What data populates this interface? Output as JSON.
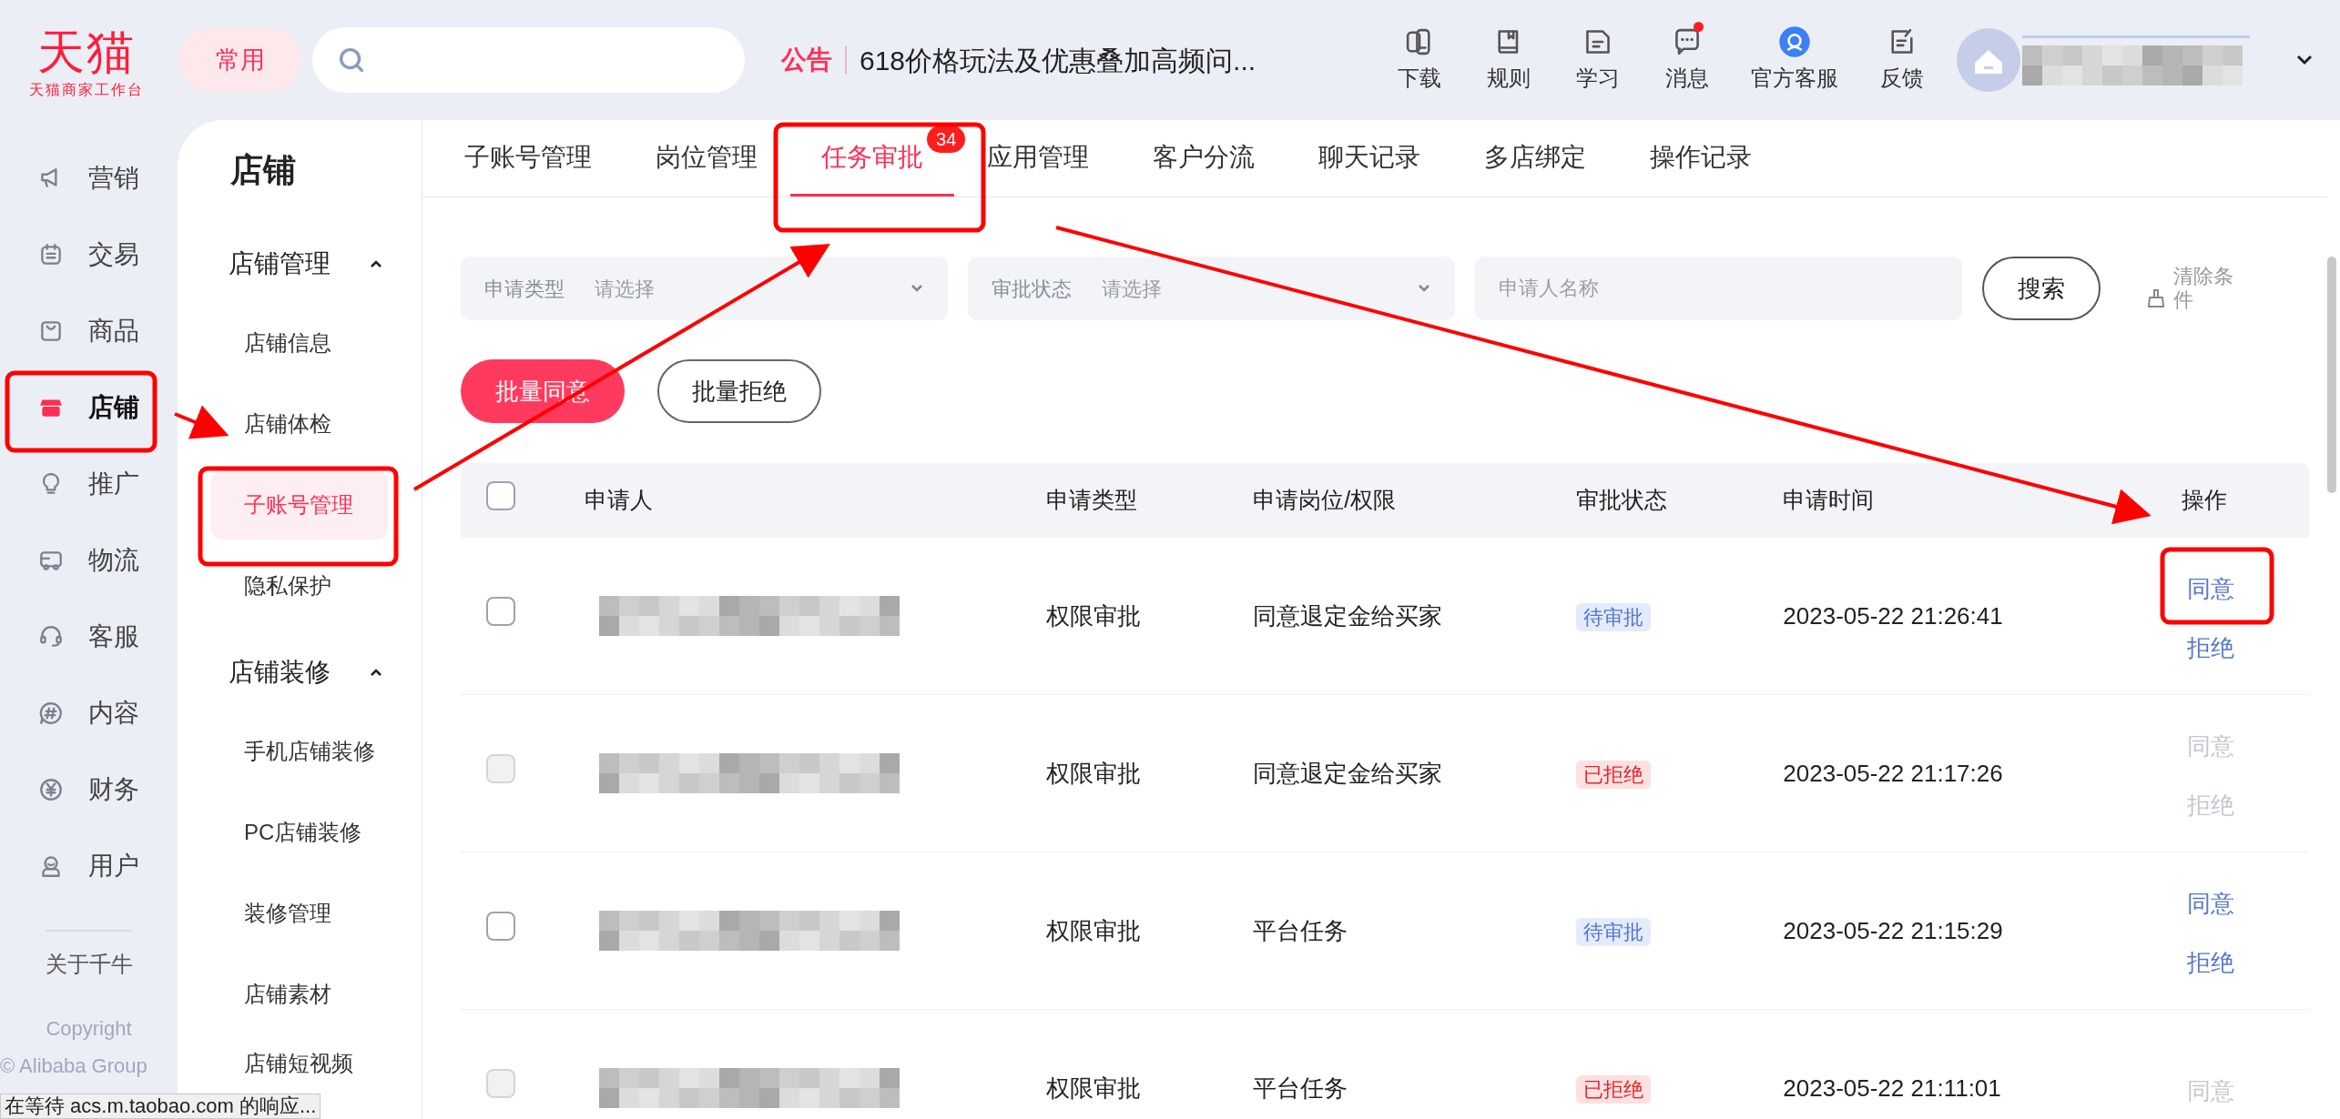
{
  "logo": {
    "name": "天猫",
    "subtitle": "天猫商家工作台"
  },
  "header": {
    "common_button": "常用",
    "notice_label": "公告",
    "notice_text": "618价格玩法及优惠叠加高频问...",
    "tools": [
      {
        "label": "下载",
        "kind": "download",
        "badge": false
      },
      {
        "label": "规则",
        "kind": "book",
        "badge": false
      },
      {
        "label": "学习",
        "kind": "doc",
        "badge": false
      },
      {
        "label": "消息",
        "kind": "chat",
        "badge": true
      },
      {
        "label": "官方客服",
        "kind": "service",
        "badge": false
      },
      {
        "label": "反馈",
        "kind": "feedback",
        "badge": false
      }
    ]
  },
  "nav": {
    "items": [
      {
        "label": "营销",
        "kind": "megaphone",
        "selected": false
      },
      {
        "label": "交易",
        "kind": "calendar",
        "selected": false
      },
      {
        "label": "商品",
        "kind": "bag",
        "selected": false
      },
      {
        "label": "店铺",
        "kind": "store",
        "selected": true
      },
      {
        "label": "推广",
        "kind": "bulb",
        "selected": false
      },
      {
        "label": "物流",
        "kind": "truck",
        "selected": false
      },
      {
        "label": "客服",
        "kind": "headset",
        "selected": false
      },
      {
        "label": "内容",
        "kind": "hash",
        "selected": false
      },
      {
        "label": "财务",
        "kind": "yen",
        "selected": false
      },
      {
        "label": "用户",
        "kind": "user",
        "selected": false
      }
    ],
    "about": "关于千牛",
    "copyright": "Copyright",
    "company": "© Alibaba Group"
  },
  "sidebar": {
    "title": "店铺",
    "groups": [
      {
        "label": "店铺管理",
        "expanded": true,
        "items": [
          {
            "label": "店铺信息",
            "selected": false
          },
          {
            "label": "店铺体检",
            "selected": false
          },
          {
            "label": "子账号管理",
            "selected": true
          },
          {
            "label": "隐私保护",
            "selected": false
          }
        ]
      },
      {
        "label": "店铺装修",
        "expanded": true,
        "items": [
          {
            "label": "手机店铺装修",
            "selected": false
          },
          {
            "label": "PC店铺装修",
            "selected": false
          },
          {
            "label": "装修管理",
            "selected": false
          },
          {
            "label": "店铺素材",
            "selected": false
          },
          {
            "label": "店铺短视频",
            "selected": false
          }
        ]
      }
    ]
  },
  "tabs": [
    {
      "label": "子账号管理",
      "selected": false
    },
    {
      "label": "岗位管理",
      "selected": false
    },
    {
      "label": "任务审批",
      "selected": true,
      "badge": "34"
    },
    {
      "label": "应用管理",
      "selected": false
    },
    {
      "label": "客户分流",
      "selected": false
    },
    {
      "label": "聊天记录",
      "selected": false
    },
    {
      "label": "多店绑定",
      "selected": false
    },
    {
      "label": "操作记录",
      "selected": false
    }
  ],
  "filters": {
    "type": {
      "label": "申请类型",
      "placeholder": "请选择"
    },
    "status": {
      "label": "审批状态",
      "placeholder": "请选择"
    },
    "name": {
      "placeholder": "申请人名称"
    },
    "search_button": "搜索",
    "clear": "清除条件"
  },
  "batch_buttons": [
    {
      "label": "批量同意",
      "kind": "primary"
    },
    {
      "label": "批量拒绝",
      "kind": "outline"
    }
  ],
  "table": {
    "select_all_checked": false,
    "columns": [
      "申请人",
      "申请类型",
      "申请岗位/权限",
      "审批状态",
      "申请时间",
      "操作"
    ],
    "rows": [
      {
        "type": "权限审批",
        "permission": "同意退定金给买家",
        "status": "待审批",
        "rejected": false,
        "time": "2023-05-22 21:26:41",
        "approve": "同意",
        "reject": "拒绝",
        "disabled": false
      },
      {
        "type": "权限审批",
        "permission": "同意退定金给买家",
        "status": "已拒绝",
        "rejected": true,
        "time": "2023-05-22 21:17:26",
        "approve": "同意",
        "reject": "拒绝",
        "disabled": true
      },
      {
        "type": "权限审批",
        "permission": "平台任务",
        "status": "待审批",
        "rejected": false,
        "time": "2023-05-22 21:15:29",
        "approve": "同意",
        "reject": "拒绝",
        "disabled": false
      },
      {
        "type": "权限审批",
        "permission": "平台任务",
        "status": "已拒绝",
        "rejected": true,
        "time": "2023-05-22 21:11:01",
        "approve": "同意",
        "disabled": true
      }
    ]
  },
  "status_bar": "在等待 acs.m.taobao.com 的响应..."
}
